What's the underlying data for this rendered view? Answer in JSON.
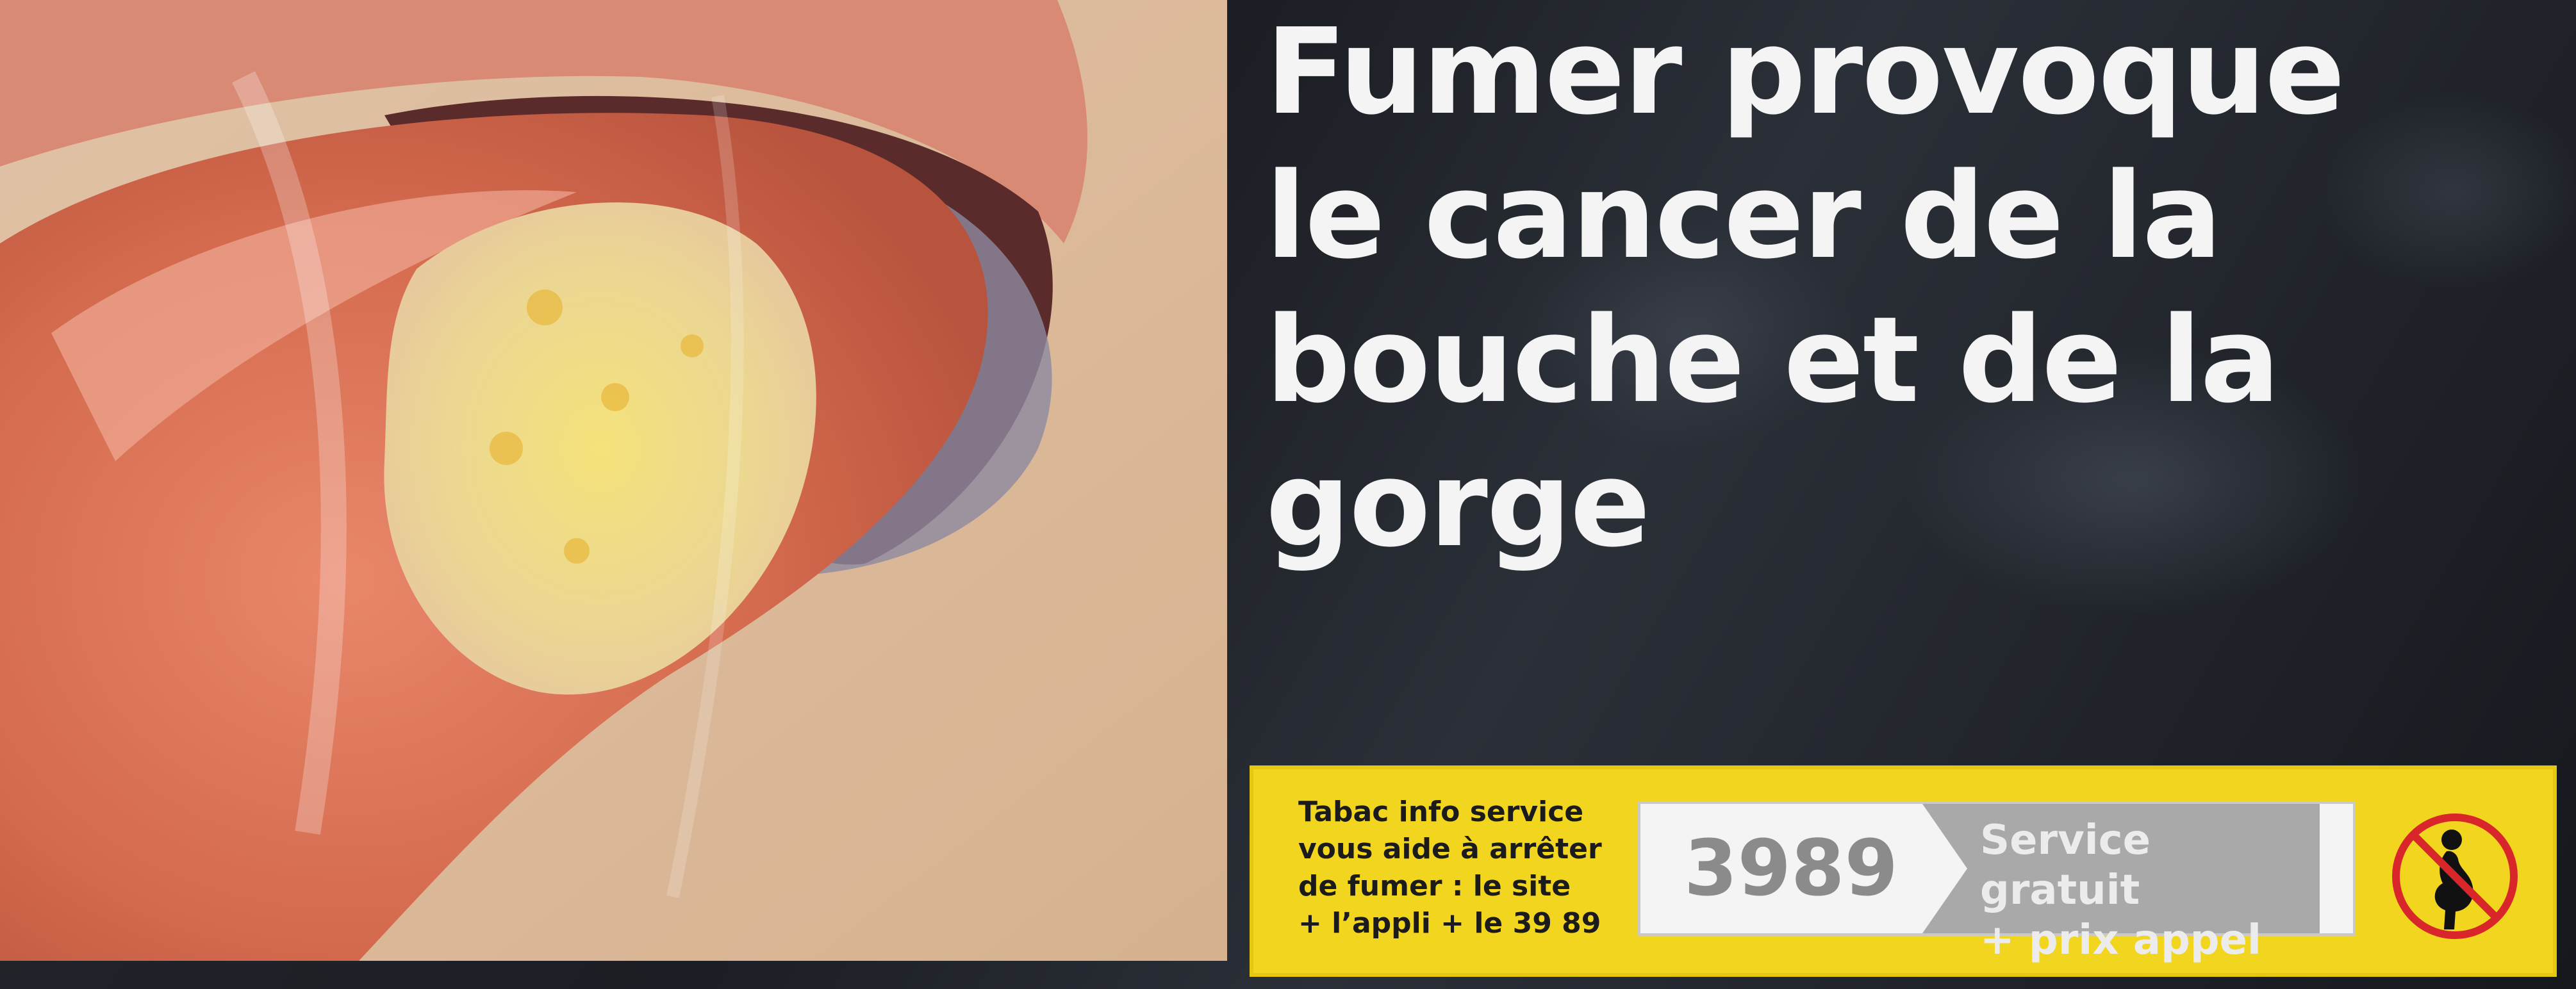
{
  "warning": {
    "headline": "Fumer provoque\nle cancer de la\nbouche et de la\ngorge"
  },
  "info": {
    "text": "Tabac info service\nvous aide à arrêter\nde fumer : le site\n+ l’appli + le 39 89",
    "phone_number": "3989",
    "service_label": "Service gratuit\n+ prix appel"
  },
  "icons": {
    "pregnancy_warning": "no-pregnant-smoking-icon"
  },
  "colors": {
    "band_yellow": "#f2d51e",
    "warning_background": "#1c1f25",
    "headline_text": "#f4f4f4",
    "prohibition_red": "#d8262b"
  }
}
